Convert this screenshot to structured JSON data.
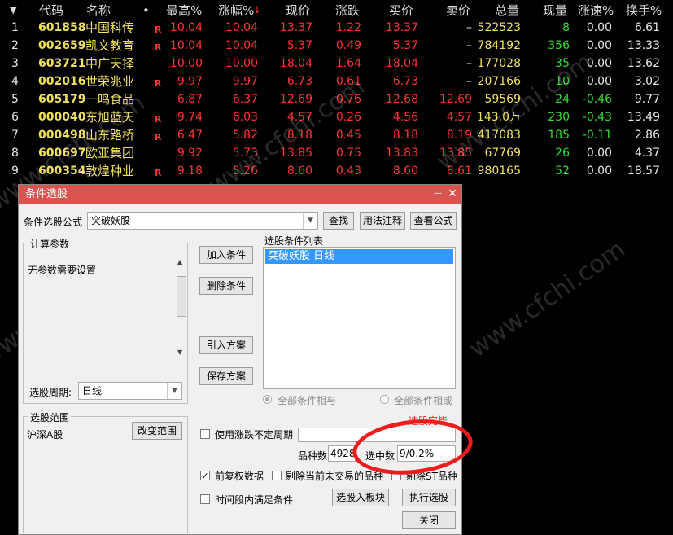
{
  "table": {
    "sort_arrow": "▼",
    "headers": [
      "代码",
      "名称",
      "•",
      "最高%",
      "涨幅%",
      "现价",
      "涨跌",
      "买价",
      "卖价",
      "总量",
      "现量",
      "涨速%",
      "换手%"
    ],
    "rows": [
      {
        "idx": "1",
        "code": "601858",
        "name": "中国科传",
        "flag": "R",
        "high": "10.04",
        "chg_pct": "10.04",
        "price": "13.37",
        "chg": "1.22",
        "bid": "13.37",
        "ask": "–",
        "vol": "522523",
        "cur_vol": "8",
        "speed": "0.00",
        "turnover": "6.61"
      },
      {
        "idx": "2",
        "code": "002659",
        "name": "凯文教育",
        "flag": "R",
        "high": "10.04",
        "chg_pct": "10.04",
        "price": "5.37",
        "chg": "0.49",
        "bid": "5.37",
        "ask": "–",
        "vol": "784192",
        "cur_vol": "356",
        "speed": "0.00",
        "turnover": "13.33"
      },
      {
        "idx": "3",
        "code": "603721",
        "name": "中广天择",
        "flag": "",
        "high": "10.00",
        "chg_pct": "10.00",
        "price": "18.04",
        "chg": "1.64",
        "bid": "18.04",
        "ask": "–",
        "vol": "177028",
        "cur_vol": "35",
        "speed": "0.00",
        "turnover": "13.62"
      },
      {
        "idx": "4",
        "code": "002016",
        "name": "世荣兆业",
        "flag": "R",
        "high": "9.97",
        "chg_pct": "9.97",
        "price": "6.73",
        "chg": "0.61",
        "bid": "6.73",
        "ask": "–",
        "vol": "207166",
        "cur_vol": "10",
        "speed": "0.00",
        "turnover": "3.02"
      },
      {
        "idx": "5",
        "code": "605179",
        "name": "一鸣食品",
        "flag": "",
        "high": "6.87",
        "chg_pct": "6.37",
        "price": "12.69",
        "chg": "0.76",
        "bid": "12.68",
        "ask": "12.69",
        "vol": "59569",
        "cur_vol": "24",
        "speed": "-0.46",
        "turnover": "9.77"
      },
      {
        "idx": "6",
        "code": "000040",
        "name": "东旭蓝天",
        "flag": "R",
        "high": "9.74",
        "chg_pct": "6.03",
        "price": "4.57",
        "chg": "0.26",
        "bid": "4.56",
        "ask": "4.57",
        "vol": "143.0万",
        "cur_vol": "230",
        "speed": "-0.43",
        "turnover": "13.49"
      },
      {
        "idx": "7",
        "code": "000498",
        "name": "山东路桥",
        "flag": "R",
        "high": "6.47",
        "chg_pct": "5.82",
        "price": "8.18",
        "chg": "0.45",
        "bid": "8.18",
        "ask": "8.19",
        "vol": "417083",
        "cur_vol": "185",
        "speed": "-0.11",
        "turnover": "2.86"
      },
      {
        "idx": "8",
        "code": "600697",
        "name": "欧亚集团",
        "flag": "",
        "high": "9.92",
        "chg_pct": "5.73",
        "price": "13.85",
        "chg": "0.75",
        "bid": "13.83",
        "ask": "13.85",
        "vol": "67769",
        "cur_vol": "26",
        "speed": "0.00",
        "turnover": "4.37"
      },
      {
        "idx": "9",
        "code": "600354",
        "name": "敦煌种业",
        "flag": "R",
        "high": "9.18",
        "chg_pct": "5.26",
        "price": "8.60",
        "chg": "0.43",
        "bid": "8.60",
        "ask": "8.61",
        "vol": "980165",
        "cur_vol": "52",
        "speed": "0.00",
        "turnover": "18.57"
      }
    ]
  },
  "dialog": {
    "title": "条件选股",
    "minimize_icon": "—",
    "close_icon": "✕",
    "formula_label": "条件选股公式",
    "formula_value": "突破妖股      -",
    "find_button": "查找",
    "usage_button": "用法注释",
    "view_formula_button": "查看公式",
    "params_group": "计算参数",
    "params_text": "无参数需要设置",
    "period_label": "选股周期:",
    "period_value": "日线",
    "add_condition": "加入条件",
    "delete_condition": "删除条件",
    "import_plan": "引入方案",
    "save_plan": "保存方案",
    "condition_list_label": "选股条件列表",
    "condition_item": "突破妖股  日线",
    "radio_and": "全部条件相与",
    "radio_or": "全部条件相或",
    "range_group": "选股范围",
    "range_value": "沪深A股",
    "change_range": "改变范围",
    "status_text": "选股完毕.",
    "use_period_check": "使用涨跌不定周期",
    "variety_count_label": "品种数",
    "variety_count_value": "4928",
    "selected_label": "选中数",
    "selected_value": "9/0.2%",
    "prior_adjust_check": "前复权数据",
    "exclude_untraded_check": "剔除当前未交易的品种",
    "exclude_st_check": "剔除ST品种",
    "period_satisfy_check": "时间段内满足条件",
    "to_board_button": "选股入板块",
    "execute_button": "执行选股",
    "close_button": "关闭"
  },
  "watermark": "www.cfchi.com",
  "colors": {
    "titlebar": "#d9534f",
    "highlight_ellipse": "#ee1c1c",
    "rise": "#ff3333",
    "fall": "#33dd33",
    "code": "#f0e060"
  }
}
